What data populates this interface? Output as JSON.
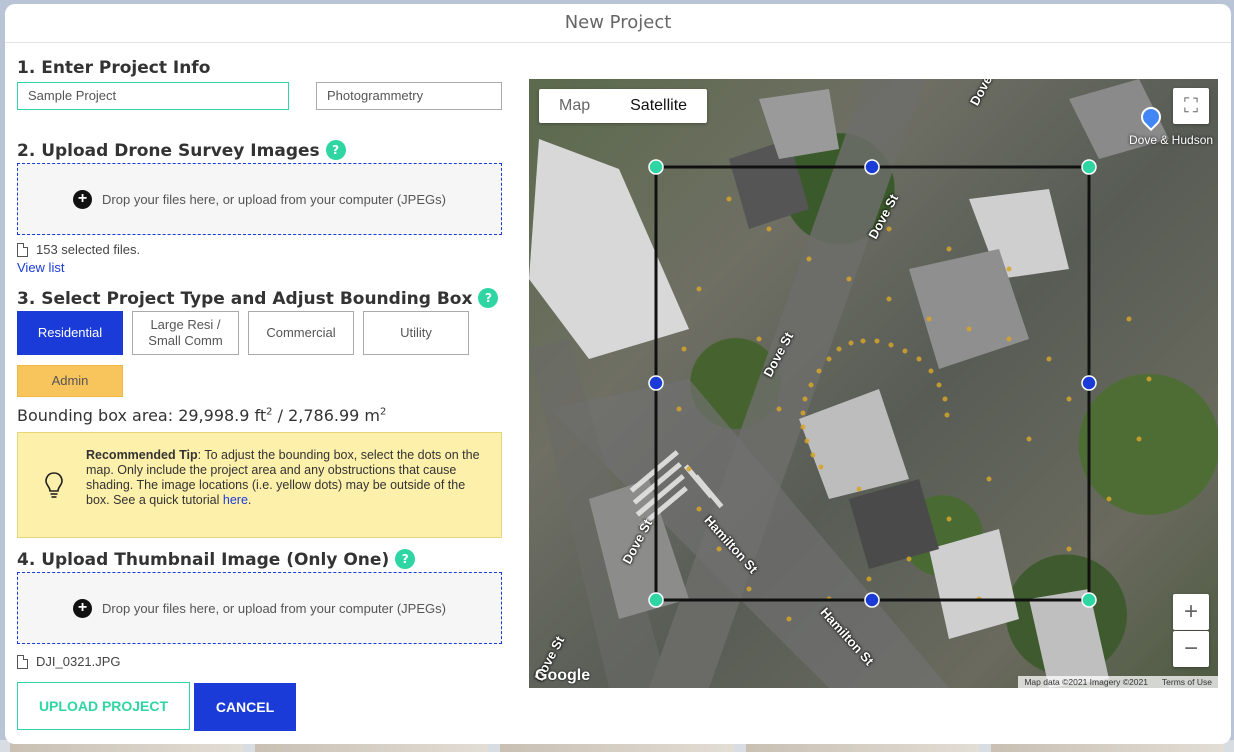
{
  "modal": {
    "title": "New Project"
  },
  "step1": {
    "heading": "1. Enter Project Info",
    "project_name_value": "Sample Project",
    "project_kind_value": "Photogrammetry"
  },
  "step2": {
    "heading": "2. Upload Drone Survey Images",
    "dropzone_text": "Drop your files here, or upload from your computer (JPEGs)",
    "selected_files": "153 selected files.",
    "view_list": "View list"
  },
  "step3": {
    "heading": "3. Select Project Type and Adjust Bounding Box",
    "types": [
      "Residential",
      "Large Resi /\nSmall Comm",
      "Commercial",
      "Utility"
    ],
    "admin": "Admin",
    "area_prefix": "Bounding box area: 29,998.9 ft",
    "area_mid": " / 2,786.99 m",
    "area_sup": "2",
    "tip_title": "Recommended Tip",
    "tip_body": ": To adjust the bounding box, select the dots on the map. Only include the project area and any obstructions that cause shading. The image locations (i.e. yellow dots) may be outside of the box. See a quick tutorial ",
    "tip_link": "here",
    "tip_end": "."
  },
  "step4": {
    "heading": "4. Upload Thumbnail Image (Only One)",
    "dropzone_text": "Drop your files here, or upload from your computer (JPEGs)",
    "selected_file": "DJI_0321.JPG"
  },
  "actions": {
    "upload": "UPLOAD PROJECT",
    "cancel": "CANCEL"
  },
  "map": {
    "toggle": {
      "map": "Map",
      "satellite": "Satellite"
    },
    "poi": "Dove & Hudson",
    "streets": {
      "dove_1": "Dove St",
      "dove_2": "Dove St",
      "dove_3": "Dove St",
      "dove_4": "Dove St",
      "dove_top": "Dove",
      "hamilton_1": "Hamilton St",
      "hamilton_2": "Hamilton St"
    },
    "zoom_in": "+",
    "zoom_out": "−",
    "fullscreen": "⛶",
    "google": "Google",
    "attribution": "Map data ©2021 Imagery ©2021",
    "terms": "Terms of Use"
  },
  "colors": {
    "accent_blue": "#1a3bd8",
    "accent_green": "#2fd6a4",
    "admin_yellow": "#f8c45c",
    "tip_bg": "#fdf0ab"
  }
}
